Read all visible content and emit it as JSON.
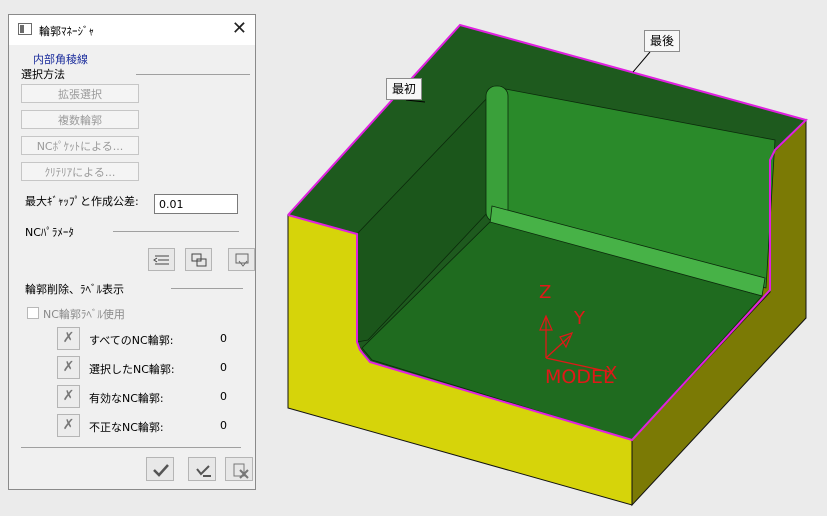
{
  "dialog": {
    "title": "輪郭ﾏﾈｰｼﾞｬ",
    "subtitle": "内部角稜線",
    "selection_header": "選択方法",
    "buttons": [
      "拡張選択",
      "複数輪郭",
      "NCﾎﾟｹｯﾄによる...",
      "ｸﾘﾃﾘｱによる..."
    ],
    "tolerance_label": "最大ｷﾞｬｯﾌﾟと作成公差:",
    "tolerance_value": "0.01",
    "nc_params_header": "NCﾊﾟﾗﾒｰﾀ",
    "delete_header": "輪郭削除、ﾗﾍﾞﾙ表示",
    "use_label_checkbox": "NC輪郭ﾗﾍﾞﾙ使用",
    "use_label_checked": false,
    "rows": [
      {
        "label": "すべてのNC輪郭:",
        "value": "0"
      },
      {
        "label": "選択したNC輪郭:",
        "value": "0"
      },
      {
        "label": "有効なNC輪郭:",
        "value": "0"
      },
      {
        "label": "不正なNC輪郭:",
        "value": "0"
      }
    ]
  },
  "viewport": {
    "tag_first": "最初",
    "tag_last": "最後",
    "axis_z": "Z",
    "axis_y": "Y",
    "axis_x": "X",
    "model_label": "MODEL"
  },
  "colors": {
    "inner_green": "#1f6b1f",
    "wall_green": "#2f8f2f",
    "top_face": "#1e5a1e",
    "side_yellow": "#d6d40a",
    "side_dark": "#7c7c00",
    "contour": "#e020e0",
    "axis": "#e01818"
  }
}
